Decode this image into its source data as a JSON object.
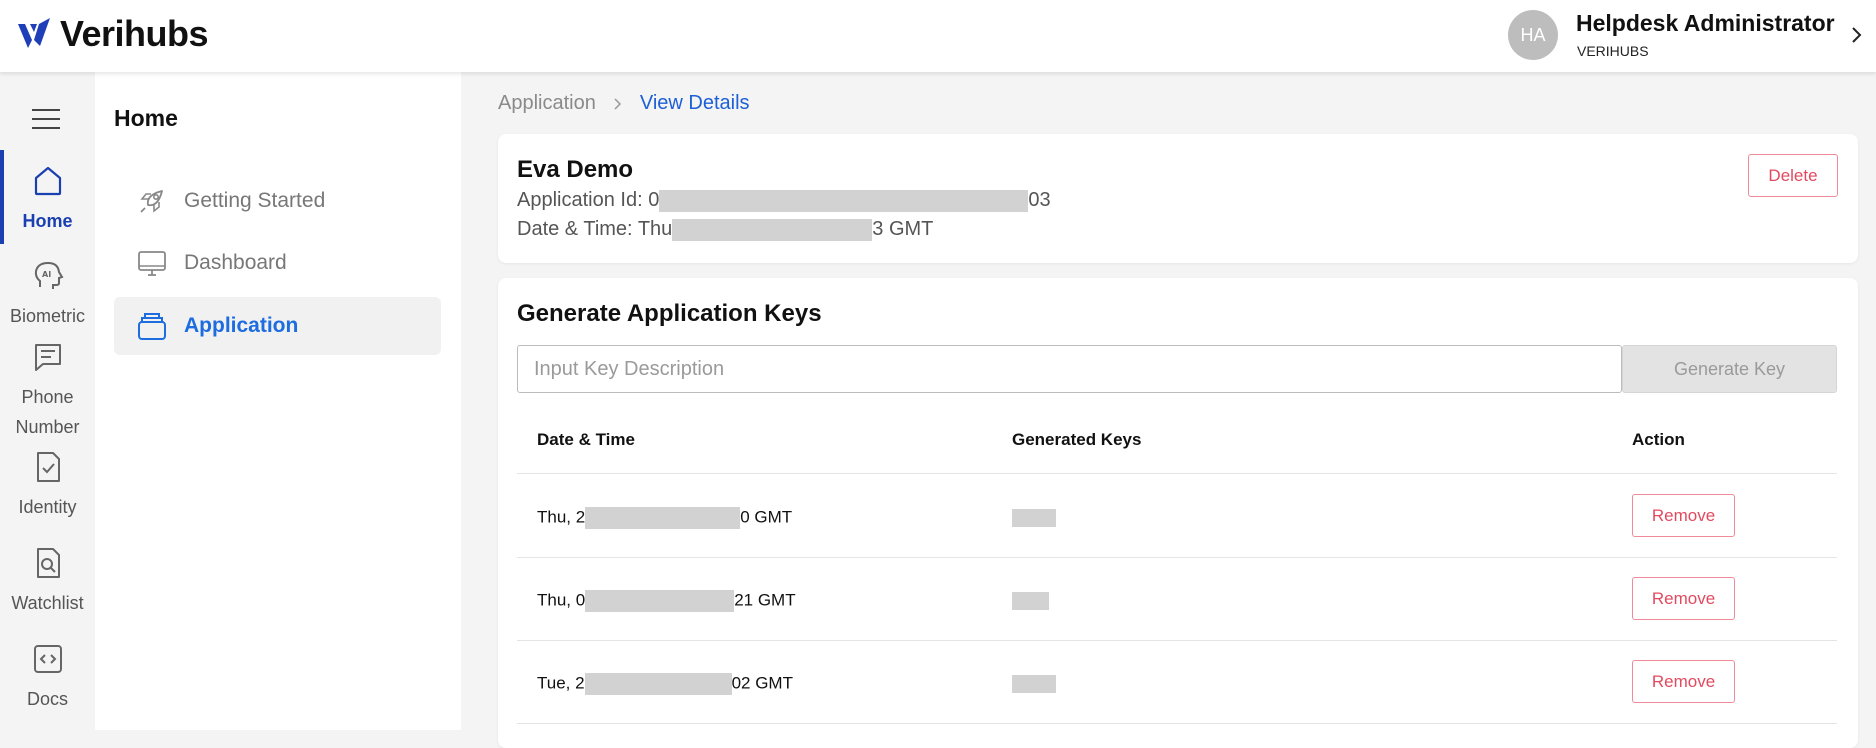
{
  "app": {
    "brand": "Verihubs"
  },
  "user": {
    "initials": "HA",
    "name": "Helpdesk Administrator",
    "org": "VERIHUBS"
  },
  "rail": {
    "items": [
      {
        "label": "Home",
        "icon": "home-icon",
        "active": true
      },
      {
        "label": "Biometric",
        "icon": "ai-head-icon"
      },
      {
        "label": "Phone Number",
        "icon": "message-icon"
      },
      {
        "label": "Identity",
        "icon": "document-check-icon"
      },
      {
        "label": "Watchlist",
        "icon": "document-search-icon"
      },
      {
        "label": "Docs",
        "icon": "code-icon"
      }
    ]
  },
  "sidebar": {
    "title": "Home",
    "items": [
      {
        "label": "Getting Started",
        "icon": "rocket-icon"
      },
      {
        "label": "Dashboard",
        "icon": "monitor-icon"
      },
      {
        "label": "Application",
        "icon": "stack-icon",
        "active": true
      }
    ]
  },
  "breadcrumb": {
    "root": "Application",
    "current": "View Details"
  },
  "application": {
    "name": "Eva Demo",
    "id_label": "Application Id:",
    "id_prefix": "0",
    "id_suffix": "03",
    "datetime_label": "Date & Time:",
    "datetime_prefix": "Thu",
    "datetime_suffix": "3 GMT",
    "delete_label": "Delete"
  },
  "keys": {
    "title": "Generate Application Keys",
    "input_placeholder": "Input Key Description",
    "input_value": "",
    "generate_label": "Generate Key",
    "columns": {
      "datetime": "Date & Time",
      "keys": "Generated Keys",
      "action": "Action"
    },
    "rows": [
      {
        "date_prefix": "Thu, 2",
        "date_suffix": "0 GMT",
        "action": "Remove"
      },
      {
        "date_prefix": "Thu, 0",
        "date_suffix": "21 GMT",
        "action": "Remove"
      },
      {
        "date_prefix": "Tue, 2",
        "date_suffix": "02 GMT",
        "action": "Remove"
      }
    ]
  },
  "colors": {
    "primary": "#1a3fb0",
    "link": "#1d5fd6",
    "danger": "#e24a5f",
    "disabled_bg": "#e3e3e3",
    "redaction": "#d2d2d2"
  }
}
